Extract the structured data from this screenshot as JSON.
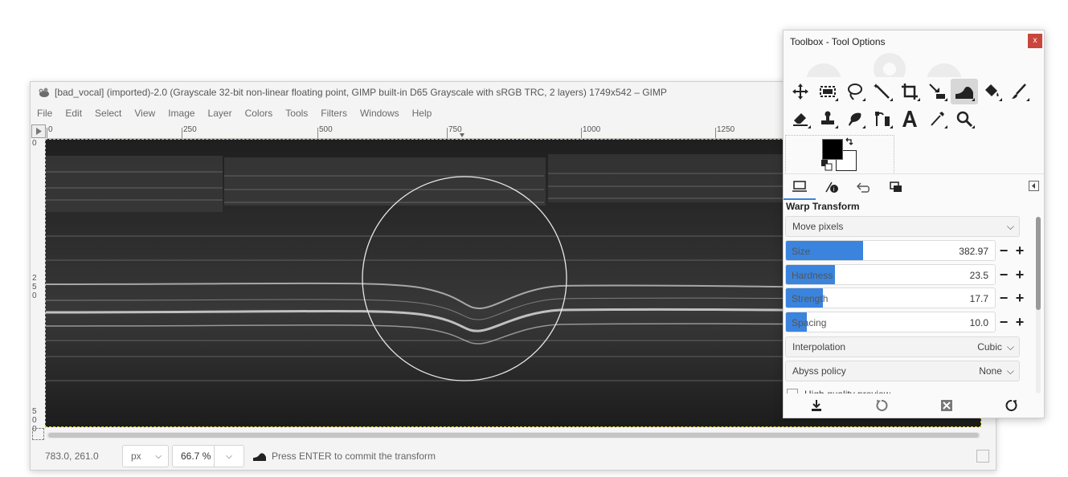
{
  "main_window": {
    "title": "[bad_vocal] (imported)-2.0 (Grayscale 32-bit non-linear floating point, GIMP built-in D65 Grayscale with sRGB TRC, 2 layers) 1749x542 – GIMP",
    "menu": [
      "File",
      "Edit",
      "Select",
      "View",
      "Image",
      "Layer",
      "Colors",
      "Tools",
      "Filters",
      "Windows",
      "Help"
    ],
    "ruler_h_labels": [
      "0",
      "250",
      "500",
      "750",
      "1000",
      "1250"
    ],
    "ruler_v_labels": [
      "0",
      "250",
      "500"
    ],
    "status": {
      "coords": "783.0, 261.0",
      "unit": "px",
      "zoom": "66.7 %",
      "message": "Press ENTER to commit the transform"
    }
  },
  "toolbox": {
    "title": "Toolbox - Tool Options",
    "close_label": "x",
    "tools_row1": [
      "move-tool",
      "rect-select-tool",
      "free-select-tool",
      "fuzzy-select-tool",
      "crop-tool",
      "unified-transform-tool",
      "warp-transform-tool",
      "bucket-fill-tool",
      "paintbrush-tool"
    ],
    "tools_row2": [
      "eraser-tool",
      "clone-tool",
      "smudge-tool",
      "paths-tool",
      "text-tool",
      "color-picker-tool",
      "zoom-tool"
    ],
    "active_tool": "warp-transform-tool",
    "colors": {
      "foreground": "#000000",
      "background": "#ffffff"
    },
    "tool_options": {
      "title": "Warp Transform",
      "behavior": "Move pixels",
      "sliders": [
        {
          "label": "Size",
          "value": "382.97",
          "fill": 0.37
        },
        {
          "label": "Hardness",
          "value": "23.5",
          "fill": 0.235
        },
        {
          "label": "Strength",
          "value": "17.7",
          "fill": 0.177
        },
        {
          "label": "Spacing",
          "value": "10.0",
          "fill": 0.1
        }
      ],
      "interpolation": {
        "label": "Interpolation",
        "value": "Cubic"
      },
      "abyss_policy": {
        "label": "Abyss policy",
        "value": "None"
      },
      "high_quality_preview": {
        "label": "High quality preview",
        "checked": false
      }
    }
  },
  "accent_color": "#3a84de"
}
